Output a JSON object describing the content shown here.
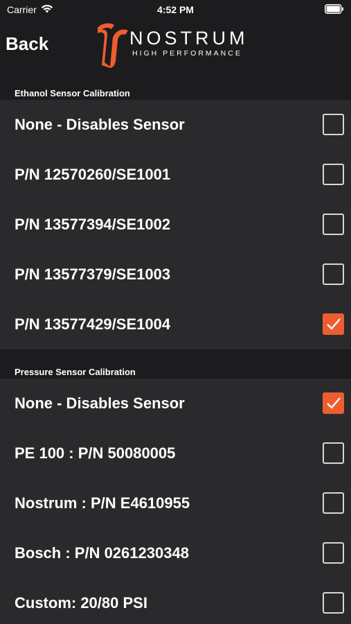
{
  "status_bar": {
    "carrier": "Carrier",
    "time": "4:52 PM"
  },
  "nav": {
    "back_label": "Back",
    "logo_name": "NOSTRUM",
    "logo_tagline": "HIGH PERFORMANCE"
  },
  "colors": {
    "accent": "#ee5d2f",
    "background": "#1c1c1e",
    "row_background": "#2a2a2c"
  },
  "ethanol_section": {
    "title": "Ethanol Sensor Calibration",
    "options": [
      {
        "label": "None - Disables Sensor",
        "checked": false
      },
      {
        "label": "P/N 12570260/SE1001",
        "checked": false
      },
      {
        "label": "P/N 13577394/SE1002",
        "checked": false
      },
      {
        "label": "P/N 13577379/SE1003",
        "checked": false
      },
      {
        "label": "P/N 13577429/SE1004",
        "checked": true
      }
    ]
  },
  "pressure_section": {
    "title": "Pressure Sensor Calibration",
    "options": [
      {
        "label": "None - Disables Sensor",
        "checked": true
      },
      {
        "label": "PE 100 : P/N 50080005",
        "checked": false
      },
      {
        "label": "Nostrum : P/N E4610955",
        "checked": false
      },
      {
        "label": "Bosch : P/N 0261230348",
        "checked": false
      },
      {
        "label": "Custom: 20/80 PSI",
        "checked": false
      }
    ]
  }
}
